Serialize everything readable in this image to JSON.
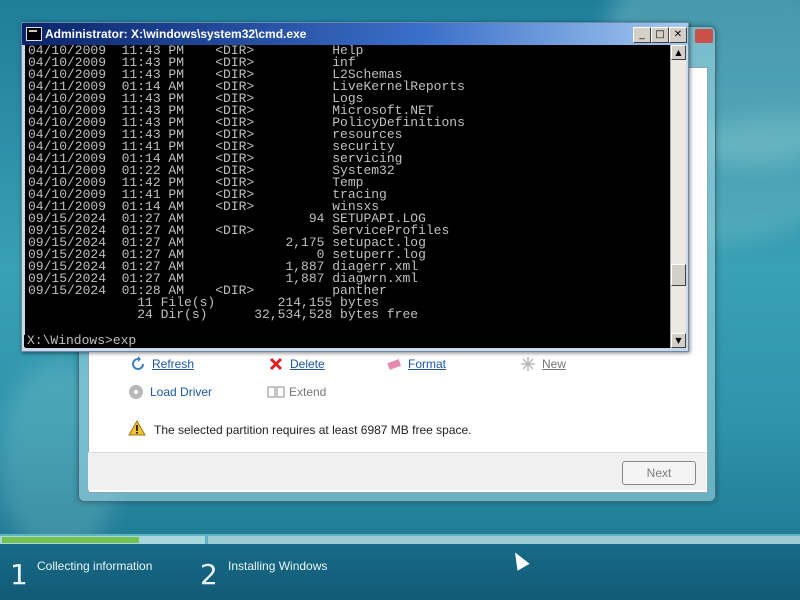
{
  "cmd_window": {
    "title": "Administrator: X:\\windows\\system32\\cmd.exe",
    "lines": [
      "04/10/2009  11:43 PM    <DIR>          Help",
      "04/10/2009  11:43 PM    <DIR>          inf",
      "04/10/2009  11:43 PM    <DIR>          L2Schemas",
      "04/11/2009  01:14 AM    <DIR>          LiveKernelReports",
      "04/10/2009  11:43 PM    <DIR>          Logs",
      "04/10/2009  11:43 PM    <DIR>          Microsoft.NET",
      "04/10/2009  11:43 PM    <DIR>          PolicyDefinitions",
      "04/10/2009  11:43 PM    <DIR>          resources",
      "04/10/2009  11:41 PM    <DIR>          security",
      "04/11/2009  01:14 AM    <DIR>          servicing",
      "04/11/2009  01:22 AM    <DIR>          System32",
      "04/10/2009  11:42 PM    <DIR>          Temp",
      "04/10/2009  11:41 PM    <DIR>          tracing",
      "04/11/2009  01:14 AM    <DIR>          winsxs",
      "09/15/2024  01:27 AM                94 SETUPAPI.LOG",
      "09/15/2024  01:27 AM    <DIR>          ServiceProfiles",
      "09/15/2024  01:27 AM             2,175 setupact.log",
      "09/15/2024  01:27 AM                 0 setuperr.log",
      "09/15/2024  01:27 AM             1,887 diagerr.xml",
      "09/15/2024  01:27 AM             1,887 diagwrn.xml",
      "09/15/2024  01:28 AM    <DIR>          panther",
      "              11 File(s)        214,155 bytes",
      "              24 Dir(s)      32,534,528 bytes free"
    ],
    "prompt": "X:\\Windows>exp",
    "buttons": {
      "minimize": "_",
      "maximize": "□",
      "close": "✕"
    }
  },
  "setup": {
    "actions": [
      {
        "label": "Refresh",
        "icon": "refresh-icon",
        "enabled": true
      },
      {
        "label": "Delete",
        "icon": "delete-icon",
        "enabled": true
      },
      {
        "label": "Format",
        "icon": "format-icon",
        "enabled": true
      },
      {
        "label": "New",
        "icon": "new-icon",
        "enabled": false
      },
      {
        "label": "Load Driver",
        "icon": "load-driver-icon",
        "enabled": true
      },
      {
        "label": "Extend",
        "icon": "extend-icon",
        "enabled": false
      }
    ],
    "warning": "The selected partition requires at least 6987 MB free space.",
    "next_label": "Next"
  },
  "progress": {
    "steps": [
      {
        "number": "1",
        "label": "Collecting information"
      },
      {
        "number": "2",
        "label": "Installing Windows"
      }
    ],
    "collecting_fill_fraction": 0.68
  },
  "colors": {
    "link": "#1a57a6",
    "progress_green": "#74c34e",
    "title_bar": "#0a246a"
  }
}
